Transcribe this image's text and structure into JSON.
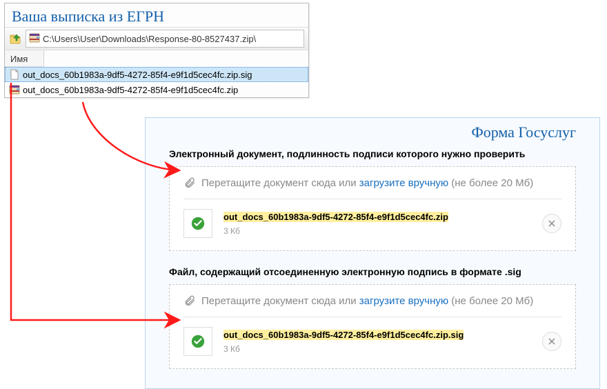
{
  "explorer": {
    "title": "Ваша выписка из ЕГРН",
    "path": "C:\\Users\\User\\Downloads\\Response-80-8527437.zip\\",
    "column_header": "Имя",
    "files": [
      {
        "name": "out_docs_60b1983a-9df5-4272-85f4-e9f1d5cec4fc.zip.sig",
        "type": "sig",
        "selected": true
      },
      {
        "name": "out_docs_60b1983a-9df5-4272-85f4-e9f1d5cec4fc.zip",
        "type": "zip",
        "selected": false
      }
    ]
  },
  "form": {
    "title": "Форма Госуслуг",
    "hint_prefix": "Перетащите документ сюда или ",
    "hint_link": "загрузите вручную",
    "hint_suffix": " (не более 20 Мб)",
    "sections": [
      {
        "label": "Электронный документ, подлинность подписи которого нужно проверить",
        "file_prefix": "out_docs_",
        "file_rest": "60b1983a-9df5-4272-85f4-e9f1d5cec4fc.zip",
        "file_size": "3 Кб"
      },
      {
        "label": "Файл, содержащий отсоединенную электронную подпись в формате .sig",
        "file_prefix": "out_docs_",
        "file_rest": "60b1983a-9df5-4272-85f4-e9f1d5cec4fc.zip.sig",
        "file_size": "3 Кб"
      }
    ]
  }
}
